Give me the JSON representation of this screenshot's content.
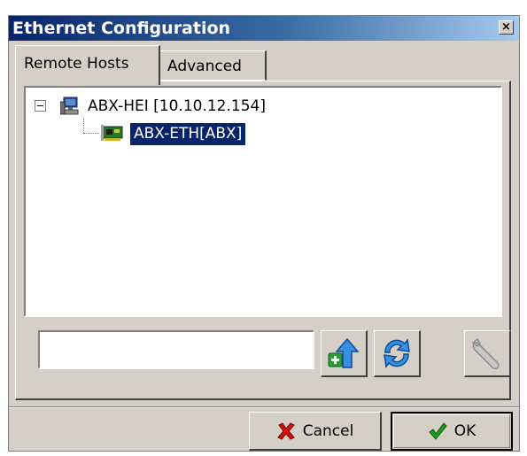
{
  "window": {
    "title": "Ethernet Configuration",
    "close_glyph": "×"
  },
  "tabs": [
    {
      "label": "Remote Hosts",
      "active": true
    },
    {
      "label": "Advanced",
      "active": false
    }
  ],
  "tree": {
    "root": {
      "label": "ABX-HEI [10.10.12.154]",
      "icon": "computer-icon",
      "expanded": true,
      "children": [
        {
          "label": "ABX-ETH[ABX]",
          "icon": "network-card-icon",
          "selected": true
        }
      ]
    }
  },
  "host_input": {
    "value": "",
    "placeholder": ""
  },
  "toolbar": {
    "add_icon": "add-upload-icon",
    "refresh_icon": "refresh-icon",
    "settings_icon": "wrench-icon",
    "settings_enabled": false
  },
  "buttons": {
    "cancel_label": "Cancel",
    "ok_label": "OK"
  },
  "colors": {
    "title_gradient_start": "#0a246a",
    "title_gradient_end": "#a6caf0",
    "selection": "#0a246a",
    "dialog_face": "#d4d0c8"
  }
}
